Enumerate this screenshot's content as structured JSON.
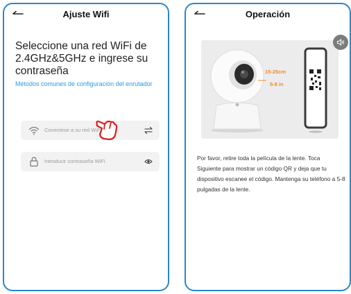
{
  "left_screen": {
    "header": {
      "title": "Ajuste Wifi",
      "back_icon": "back-arrow-icon"
    },
    "heading": "Seleccione una red WiFi de 2.4GHz&5GHz e ingrese su contraseña",
    "config_link": "Métodos comunes de configuración del enrutador",
    "network_field": {
      "placeholder": "Conectese a su red WiFi",
      "icon": "wifi-icon",
      "action_icon": "swap-arrows-icon"
    },
    "password_field": {
      "placeholder": "Introducir contraseña WiFi",
      "icon": "lock-icon",
      "action_icon": "eye-icon"
    },
    "pointer_icon": "hand-pointer-icon"
  },
  "right_screen": {
    "header": {
      "title": "Operación",
      "back_icon": "back-arrow-icon"
    },
    "speaker_icon": "speaker-icon",
    "illustration": {
      "distance_cm": "15-25cm",
      "distance_in": "5-8 in"
    },
    "instructions": "Por favor, retire toda la película de la lente. Toca Siguiente para mostrar un código QR y deja que tu dispositivo escanee el código. Mantenga su teléfono a 5-8 pulgadas de la lente."
  },
  "colors": {
    "frame_border": "#2a86c9",
    "link": "#2a9ae0",
    "accent_orange": "#f08a2c",
    "field_bg": "#f2f2f2",
    "pointer_red": "#d62020"
  }
}
